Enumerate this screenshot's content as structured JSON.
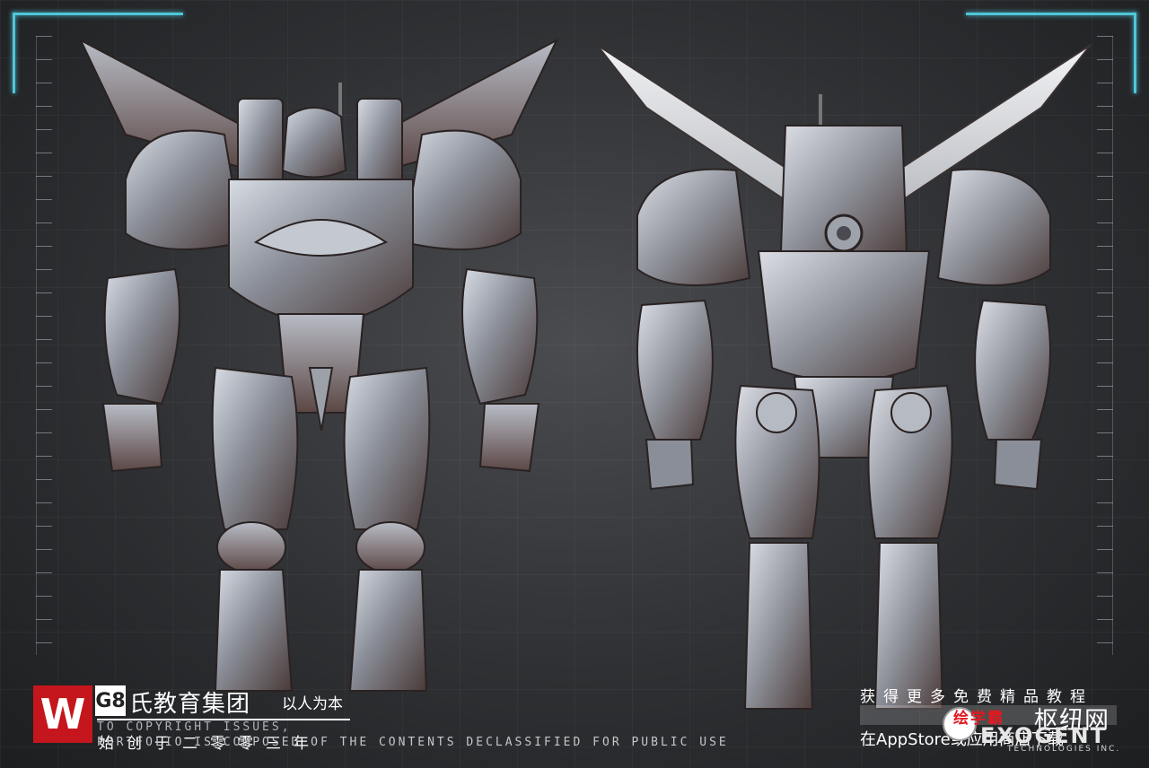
{
  "logo": {
    "mark": "W",
    "badge": "G8",
    "group_name": "氏教育集团",
    "slogan": "以人为本"
  },
  "footer": {
    "copyright_text": "TO COPYRIGHT ISSUES,",
    "founding_text": "始创于二零零三年",
    "portfolio_text": "PORTFOLIO IS COMPOSED OF THE CONTENTS DECLASSIFIED FOR PUBLIC USE"
  },
  "promo": {
    "headline": "获得更多免费精品教程",
    "appstore_prefix": "在AppStore或应用商店下载",
    "brand_red": "绘学霸",
    "brand_net": "枢纽网",
    "company": "EXOGENT",
    "company_sub": "TECHNOLOGIES INC."
  },
  "colors": {
    "accent": "#4fc6d8",
    "logo_red": "#c4161c",
    "brand_red": "#e01a22"
  }
}
